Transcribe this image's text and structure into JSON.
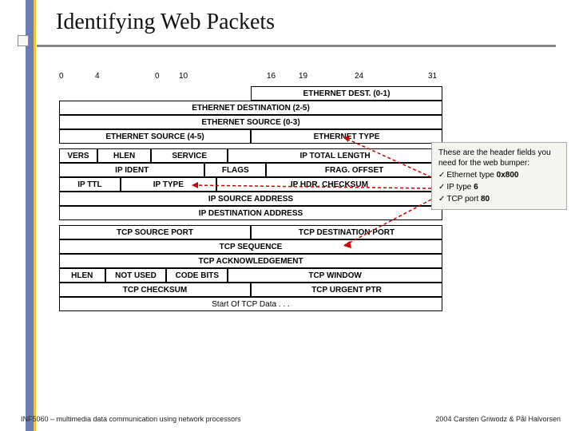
{
  "title": "Identifying Web Packets",
  "ruler": {
    "a0": "0",
    "a4": "4",
    "b0": "0",
    "a10": "10",
    "a16": "16",
    "a19": "19",
    "a24": "24",
    "a31": "31"
  },
  "rows": {
    "eth_dest01": "ETHERNET DEST. (0-1)",
    "eth_dest25": "ETHERNET DESTINATION (2-5)",
    "eth_src03": "ETHERNET SOURCE (0-3)",
    "eth_src45": "ETHERNET SOURCE (4-5)",
    "eth_type": "ETHERNET TYPE",
    "vers": "VERS",
    "hlen": "HLEN",
    "service": "SERVICE",
    "iptotlen": "IP TOTAL LENGTH",
    "ipident": "IP IDENT",
    "flags": "FLAGS",
    "fragoff": "FRAG. OFFSET",
    "ipttl": "IP TTL",
    "iptype": "IP TYPE",
    "ipcksum": "IP HDR. CHECKSUM",
    "ipsrc": "IP SOURCE ADDRESS",
    "ipdst": "IP DESTINATION ADDRESS",
    "tcpsrc": "TCP SOURCE PORT",
    "tcpdst": "TCP DESTINATION PORT",
    "tcpseq": "TCP SEQUENCE",
    "tcpack": "TCP ACKNOWLEDGEMENT",
    "t_hlen": "HLEN",
    "t_nu": "NOT USED",
    "t_cb": "CODE BITS",
    "t_win": "TCP WINDOW",
    "t_cksum": "TCP CHECKSUM",
    "t_urg": "TCP URGENT PTR",
    "t_data": "Start Of TCP Data . . ."
  },
  "note": {
    "intro": "These are the header fields you need for the web bumper:",
    "i1a": "Ethernet type ",
    "i1b": "0x800",
    "i2a": "IP type ",
    "i2b": "6",
    "i3a": "TCP port ",
    "i3b": "80"
  },
  "footer": {
    "left": "INF5060 – multimedia data communication using network processors",
    "right": "2004  Carsten Griwodz & Pål Halvorsen"
  }
}
